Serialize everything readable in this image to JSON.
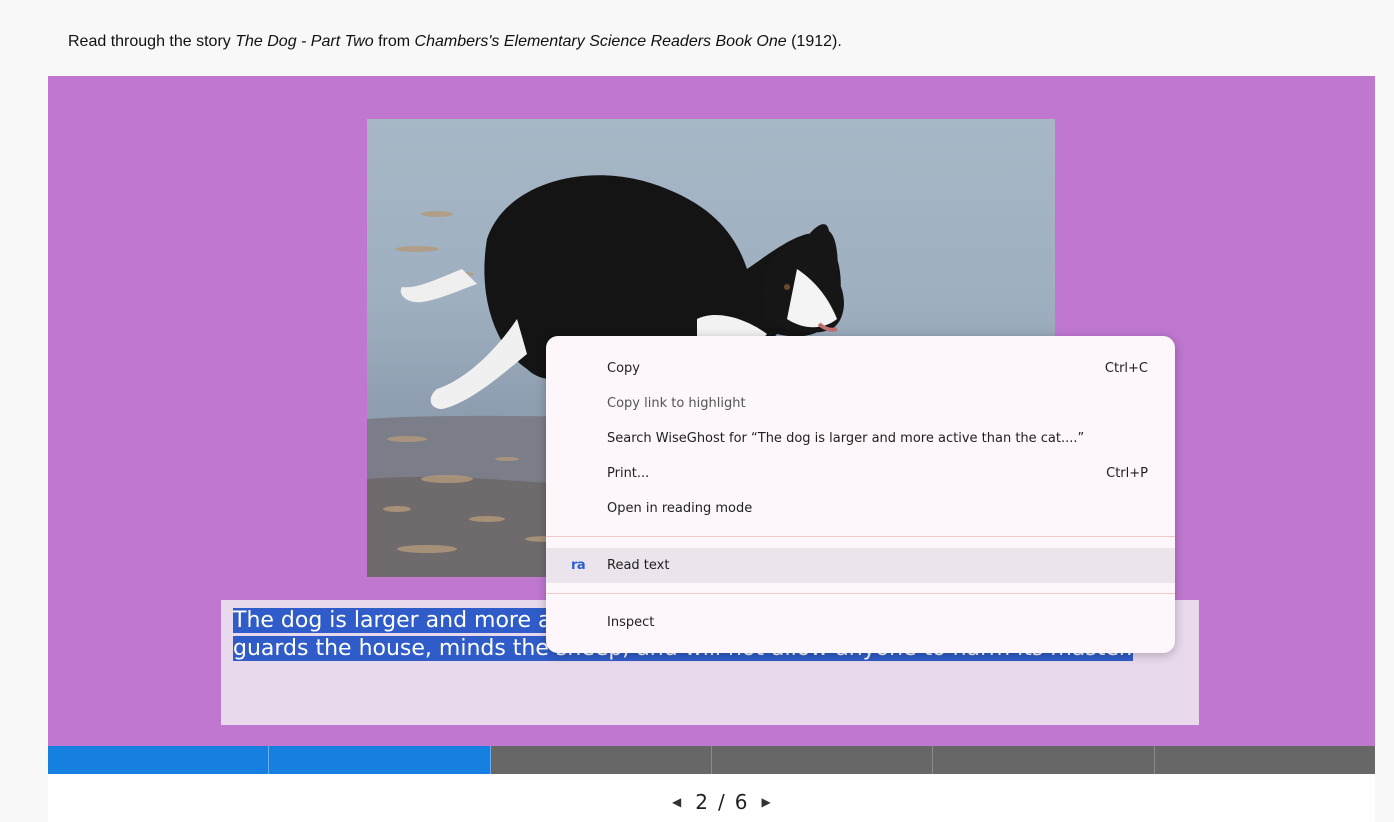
{
  "intro": {
    "prefix": "Read through the story ",
    "story_title": "The Dog - Part Two",
    "middle": " from ",
    "book_title": "Chambers's Elementary Science Readers Book One",
    "suffix": " (1912)."
  },
  "slide": {
    "background_color": "#bf77d0",
    "image_subject": "border collie dog running on beach",
    "caption_line1": "The dog is larger and more active than the cat. It",
    "caption_line2": "guards the house, minds the sheep, and will not allow anyone to harm its master."
  },
  "progress": {
    "total_segments": 6,
    "completed_segments": 2,
    "done_color": "#1580e0",
    "todo_color": "#676767"
  },
  "pager": {
    "current": "2",
    "separator": "/",
    "total": "6",
    "prev_icon": "caret-left-icon",
    "next_icon": "caret-right-icon"
  },
  "context_menu": {
    "copy": {
      "label": "Copy",
      "shortcut": "Ctrl+C"
    },
    "copy_link": {
      "label": "Copy link to highlight"
    },
    "search": {
      "label": "Search WiseGhost for “The dog is larger and more active than the cat....”"
    },
    "print": {
      "label": "Print...",
      "shortcut": "Ctrl+P"
    },
    "reading_mode": {
      "label": "Open in reading mode"
    },
    "read_text": {
      "label": "Read text",
      "icon_text": "ra"
    },
    "inspect": {
      "label": "Inspect"
    }
  }
}
